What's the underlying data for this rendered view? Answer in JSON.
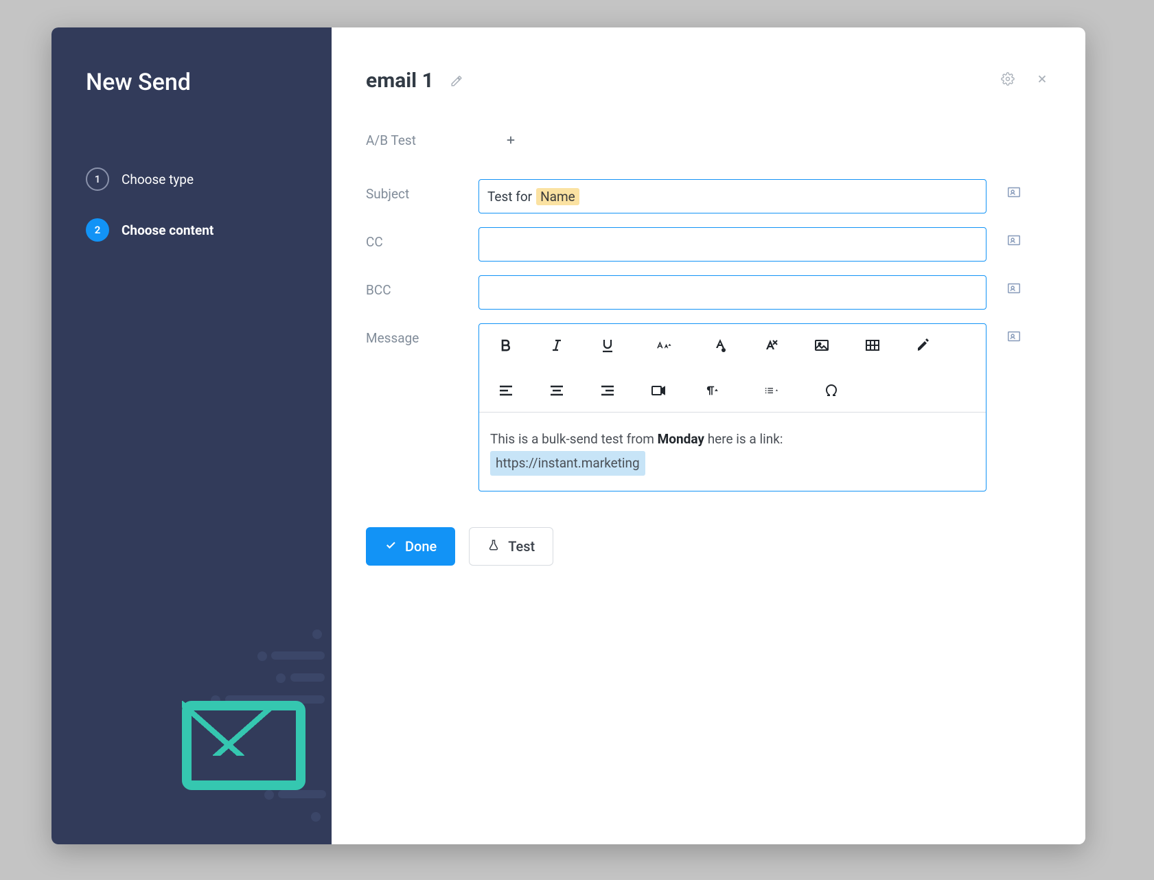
{
  "sidebar": {
    "title": "New Send",
    "steps": [
      {
        "num": "1",
        "label": "Choose type",
        "state": "pending"
      },
      {
        "num": "2",
        "label": "Choose content",
        "state": "active"
      }
    ]
  },
  "header": {
    "title": "email 1"
  },
  "form": {
    "ab_label": "A/B Test",
    "subject_label": "Subject",
    "subject_prefix": "Test for",
    "subject_token": "Name",
    "cc_label": "CC",
    "cc_value": "",
    "bcc_label": "BCC",
    "bcc_value": "",
    "message_label": "Message"
  },
  "message": {
    "text_before": "This is a bulk-send test from ",
    "bold": "Monday",
    "text_after": " here is a link: ",
    "link": "https://instant.marketing"
  },
  "buttons": {
    "done": "Done",
    "test": "Test"
  },
  "icons": {
    "pencil": "pencil-icon",
    "gear": "gear-icon",
    "close": "close-icon",
    "plus": "plus-icon",
    "contact": "contact-card-icon",
    "check": "check-icon",
    "flask": "flask-icon"
  },
  "toolbar": [
    "bold",
    "italic",
    "underline",
    "font-size",
    "font-color",
    "strikethrough",
    "image",
    "table",
    "highlighter",
    "align-left",
    "align-center",
    "align-right",
    "video",
    "paragraph",
    "list",
    "more",
    "omega"
  ]
}
